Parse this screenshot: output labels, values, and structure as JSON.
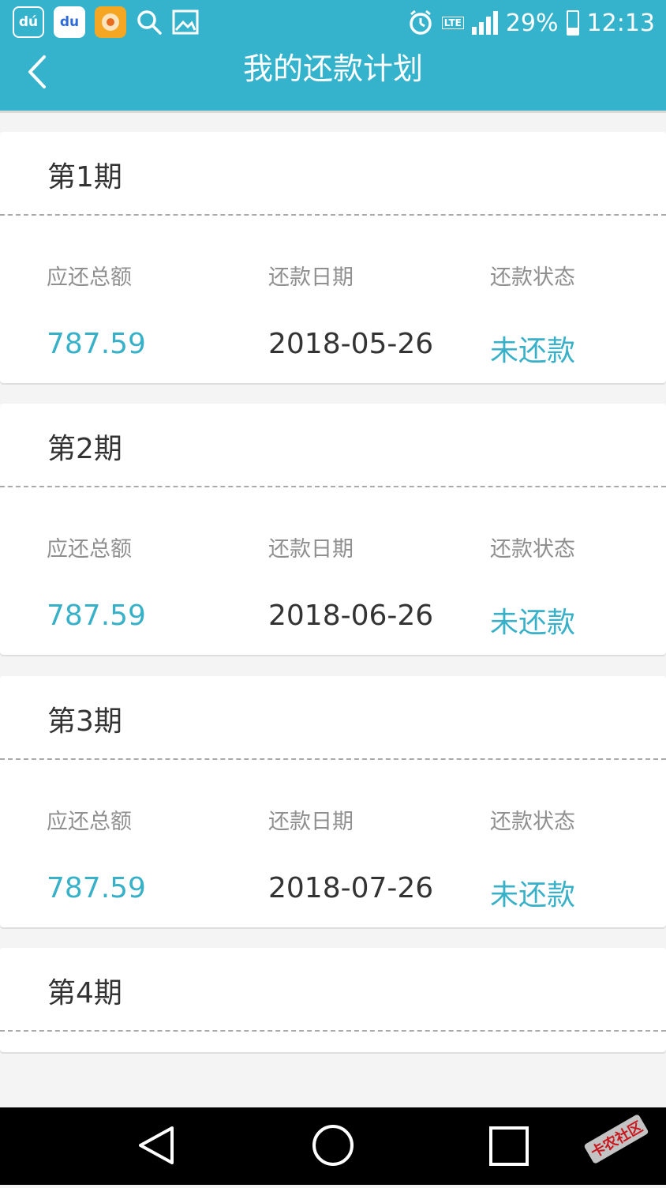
{
  "status_bar": {
    "icons": [
      {
        "name": "du-app-icon",
        "text": "dú"
      },
      {
        "name": "baidu-app-icon",
        "text": "du"
      },
      {
        "name": "game-app-icon",
        "text": ""
      },
      {
        "name": "search-icon",
        "text": ""
      },
      {
        "name": "gallery-icon",
        "text": ""
      }
    ],
    "network": "LTE",
    "battery": "29%",
    "time": "12:13"
  },
  "header": {
    "title": "我的还款计划",
    "back_icon": "chevron-left-icon"
  },
  "labels": {
    "amount": "应还总额",
    "date": "还款日期",
    "status": "还款状态"
  },
  "periods": [
    {
      "title": "第1期",
      "amount": "787.59",
      "date": "2018-05-26",
      "status": "未还款"
    },
    {
      "title": "第2期",
      "amount": "787.59",
      "date": "2018-06-26",
      "status": "未还款"
    },
    {
      "title": "第3期",
      "amount": "787.59",
      "date": "2018-07-26",
      "status": "未还款"
    },
    {
      "title": "第4期"
    }
  ],
  "colors": {
    "primary": "#35b3cc",
    "accent": "#37b0c8",
    "watermark": "#e01a22"
  },
  "nav_bar": {
    "back_icon": "triangle-back-icon",
    "home_icon": "circle-home-icon",
    "recent_icon": "square-recent-icon"
  },
  "watermark": {
    "text": "卡农社区"
  }
}
